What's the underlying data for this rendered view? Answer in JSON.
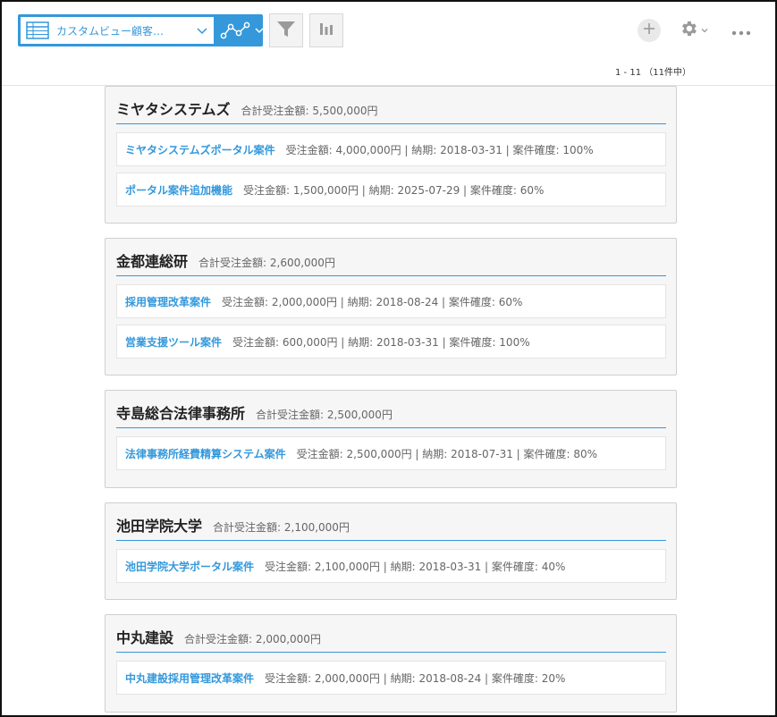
{
  "toolbar": {
    "view_label": "カスタムビュー顧客…",
    "pager_text": "1 - 11 （11件中）"
  },
  "icons": {
    "view_grid": "grid-icon",
    "graph": "line-graph-icon",
    "filter": "filter-icon",
    "report": "bar-chart-icon",
    "add": "plus-icon",
    "settings": "gear-icon",
    "more": "more-icon"
  },
  "colors": {
    "accent": "#3498db",
    "text": "#333333",
    "muted": "#666666"
  },
  "companies": [
    {
      "name": "ミヤタシステムズ",
      "total": "合計受注金額: 5,500,000円",
      "records": [
        {
          "title": "ミヤタシステムズポータル案件",
          "meta": "受注金額: 4,000,000円 | 納期: 2018-03-31 | 案件確度: 100%"
        },
        {
          "title": "ポータル案件追加機能",
          "meta": "受注金額: 1,500,000円 | 納期: 2025-07-29 | 案件確度: 60%"
        }
      ]
    },
    {
      "name": "金都連総研",
      "total": "合計受注金額: 2,600,000円",
      "records": [
        {
          "title": "採用管理改革案件",
          "meta": "受注金額: 2,000,000円 | 納期: 2018-08-24 | 案件確度: 60%"
        },
        {
          "title": "営業支援ツール案件",
          "meta": "受注金額: 600,000円 | 納期: 2018-03-31 | 案件確度: 100%"
        }
      ]
    },
    {
      "name": "寺島総合法律事務所",
      "total": "合計受注金額: 2,500,000円",
      "records": [
        {
          "title": "法律事務所経費精算システム案件",
          "meta": "受注金額: 2,500,000円 | 納期: 2018-07-31 | 案件確度: 80%"
        }
      ]
    },
    {
      "name": "池田学院大学",
      "total": "合計受注金額: 2,100,000円",
      "records": [
        {
          "title": "池田学院大学ポータル案件",
          "meta": "受注金額: 2,100,000円 | 納期: 2018-03-31 | 案件確度: 40%"
        }
      ]
    },
    {
      "name": "中丸建設",
      "total": "合計受注金額: 2,000,000円",
      "records": [
        {
          "title": "中丸建設採用管理改革案件",
          "meta": "受注金額: 2,000,000円 | 納期: 2018-08-24 | 案件確度: 20%"
        }
      ]
    }
  ]
}
